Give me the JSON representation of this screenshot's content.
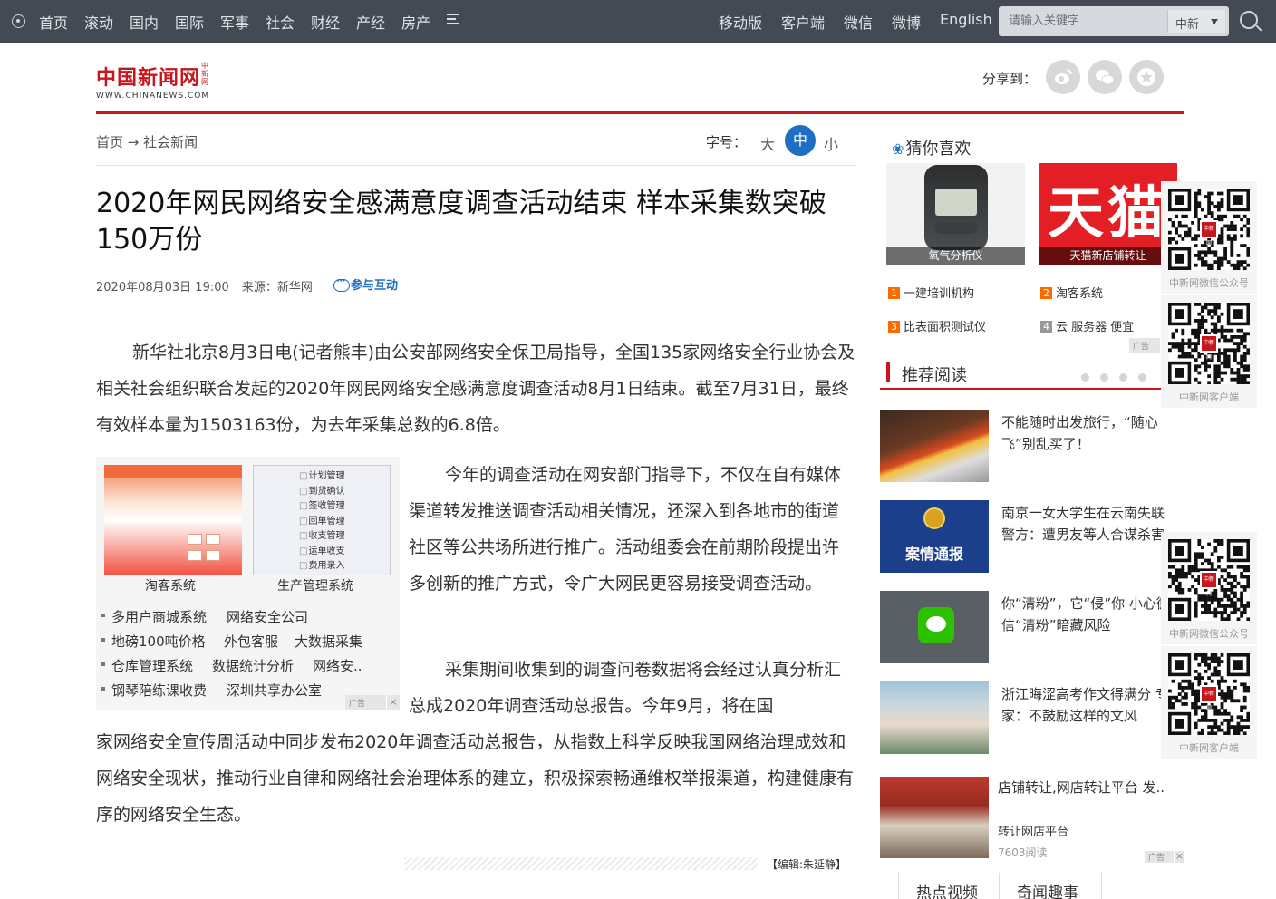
{
  "nav": {
    "left": [
      "首页",
      "滚动",
      "国内",
      "国际",
      "军事",
      "社会",
      "财经",
      "产经",
      "房产"
    ],
    "right": [
      "移动版",
      "客户端",
      "微信",
      "微博",
      "English"
    ],
    "search_placeholder": "请输入关键字",
    "search_scope": "中新"
  },
  "logo": {
    "cn": "中国新闻网",
    "en": "WWW.CHINANEWS.COM",
    "vertical": "中新网"
  },
  "share": {
    "label": "分享到："
  },
  "breadcrumb": {
    "home": "首页",
    "arrow": "→",
    "section": "社会新闻"
  },
  "font_size": {
    "label": "字号：",
    "large": "大",
    "medium": "中",
    "small": "小"
  },
  "article": {
    "title": "2020年网民网络安全感满意度调查活动结束 样本采集数突破150万份",
    "date": "2020年08月03日 19:00",
    "source": "来源：新华网",
    "interact": "参与互动",
    "p1": "新华社北京8月3日电(记者熊丰)由公安部网络安全保卫局指导，全国135家网络安全行业协会及相关社会组织联合发起的2020年网民网络安全感满意度调查活动8月1日结束。截至7月31日，最终有效样本量为1503163份，为去年采集总数的6.8倍。",
    "p2": "今年的调查活动在网安部门指导下，不仅在自有媒体渠道转发推送调查活动相关情况，还深入到各地市的街道社区等公共场所进行推广。活动组委会在前期阶段提出许多创新的推广方式，令广大网民更容易接受调查活动。",
    "p3a": "采集期间收集到的调查问卷数据将会经过认真分析汇总成2020年调查活动总报告。今年9月，将在国",
    "p3b": "家网络安全宣传周活动中同步发布2020年调查活动总报告，从指数上科学反映我国网络治理成效和网络安全现状，推动行业自律和网络社会治理体系的建立，积极探索畅通维权举报渠道，构建健康有序的网络安全生态。",
    "editor": "【编辑:朱延静】"
  },
  "inline_ad": {
    "cap1": "淘客系统",
    "cap2": "生产管理系统",
    "tree": [
      "计划管理",
      "到货确认",
      "签收管理",
      "回单管理",
      "收支管理",
      "运单收支",
      "费用录入"
    ],
    "links": [
      [
        "多用户商城系统",
        "网络安全公司"
      ],
      [
        "地磅100吨价格",
        "外包客服",
        "大数据采集"
      ],
      [
        "仓库管理系统",
        "数据统计分析",
        "网络安.."
      ],
      [
        "钢琴陪练课收费",
        "深圳共享办公室"
      ]
    ],
    "tag": "广告"
  },
  "guess": {
    "title": "猜你喜欢",
    "img1_caption": "氧气分析仪",
    "img2_big": "天猫",
    "img2_caption": "天猫新店铺转让",
    "items": [
      {
        "n": "1",
        "text": "一建培训机构"
      },
      {
        "n": "2",
        "text": "淘客系统"
      },
      {
        "n": "3",
        "text": "比表面积测试仪"
      },
      {
        "n": "4",
        "text": "云 服务器 便宜"
      }
    ],
    "tag": "广告"
  },
  "recommend": {
    "title": "推荐阅读",
    "items": [
      {
        "text": "不能随时出发旅行，“随心飞”别乱买了！"
      },
      {
        "text": "南京一女大学生在云南失联 警方：遭男友等人合谋杀害",
        "badge": "案情通报"
      },
      {
        "text": "你“清粉”，它“侵”你 小心微信“清粉”暗藏风险"
      },
      {
        "text": "浙江晦涩高考作文得满分 专家：不鼓励这样的文风"
      }
    ]
  },
  "side_ad": {
    "title": "店铺转让,网店转让平台 发..",
    "subtitle": "转让网店平台",
    "reads": "7603阅读",
    "tag": "广告"
  },
  "bottom_tabs": [
    "热点视频",
    "奇闻趣事"
  ],
  "qr": [
    {
      "caption": "中新网微信公众号"
    },
    {
      "caption": "中新网客户端"
    },
    {
      "caption": "中新网微信公众号"
    },
    {
      "caption": "中新网客户端"
    }
  ],
  "qr_logo": "中新网",
  "colors": {
    "brand_red": "#c8161d",
    "nav_bg": "#434a54",
    "accent_blue": "#1d6fc4",
    "rank_orange": "#ff6a00"
  }
}
